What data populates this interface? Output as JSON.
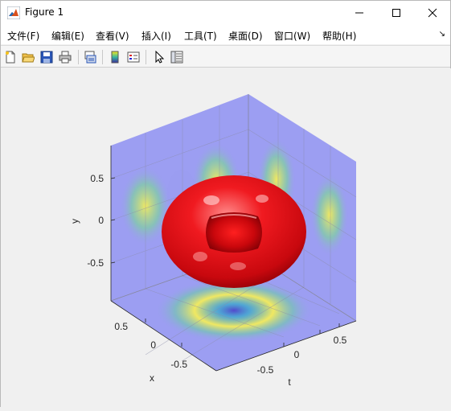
{
  "window": {
    "title": "Figure 1",
    "icon": "matlab-icon"
  },
  "menu": {
    "items": [
      "文件(F)",
      "编辑(E)",
      "查看(V)",
      "插入(I)",
      "工具(T)",
      "桌面(D)",
      "窗口(W)",
      "帮助(H)"
    ],
    "corner_icon": "dock-arrow-icon"
  },
  "toolbar": {
    "buttons": [
      "new-figure-icon",
      "open-file-icon",
      "save-icon",
      "print-icon",
      "link-plot-icon",
      "insert-colorbar-icon",
      "insert-legend-icon",
      "pointer-icon",
      "property-inspector-icon"
    ]
  },
  "chart_data": {
    "type": "surface",
    "description_series": [
      "torus surface (red)",
      "xy projection",
      "yt projection",
      "xt projection"
    ],
    "xlabel": "x",
    "ylabel": "y",
    "zlabel": "t",
    "x_ticks": [
      "0.5",
      "0",
      "-0.5"
    ],
    "y_ticks": [
      "0.5",
      "0",
      "-0.5"
    ],
    "t_ticks": [
      "-0.5",
      "0",
      "0.5"
    ],
    "xlim": [
      -1,
      1
    ],
    "ylim": [
      -1,
      1
    ],
    "tlim": [
      -1,
      1
    ],
    "surface_color": "#e8161c",
    "pane_color": "#9a9cf0",
    "projection_colormap": "parula"
  }
}
